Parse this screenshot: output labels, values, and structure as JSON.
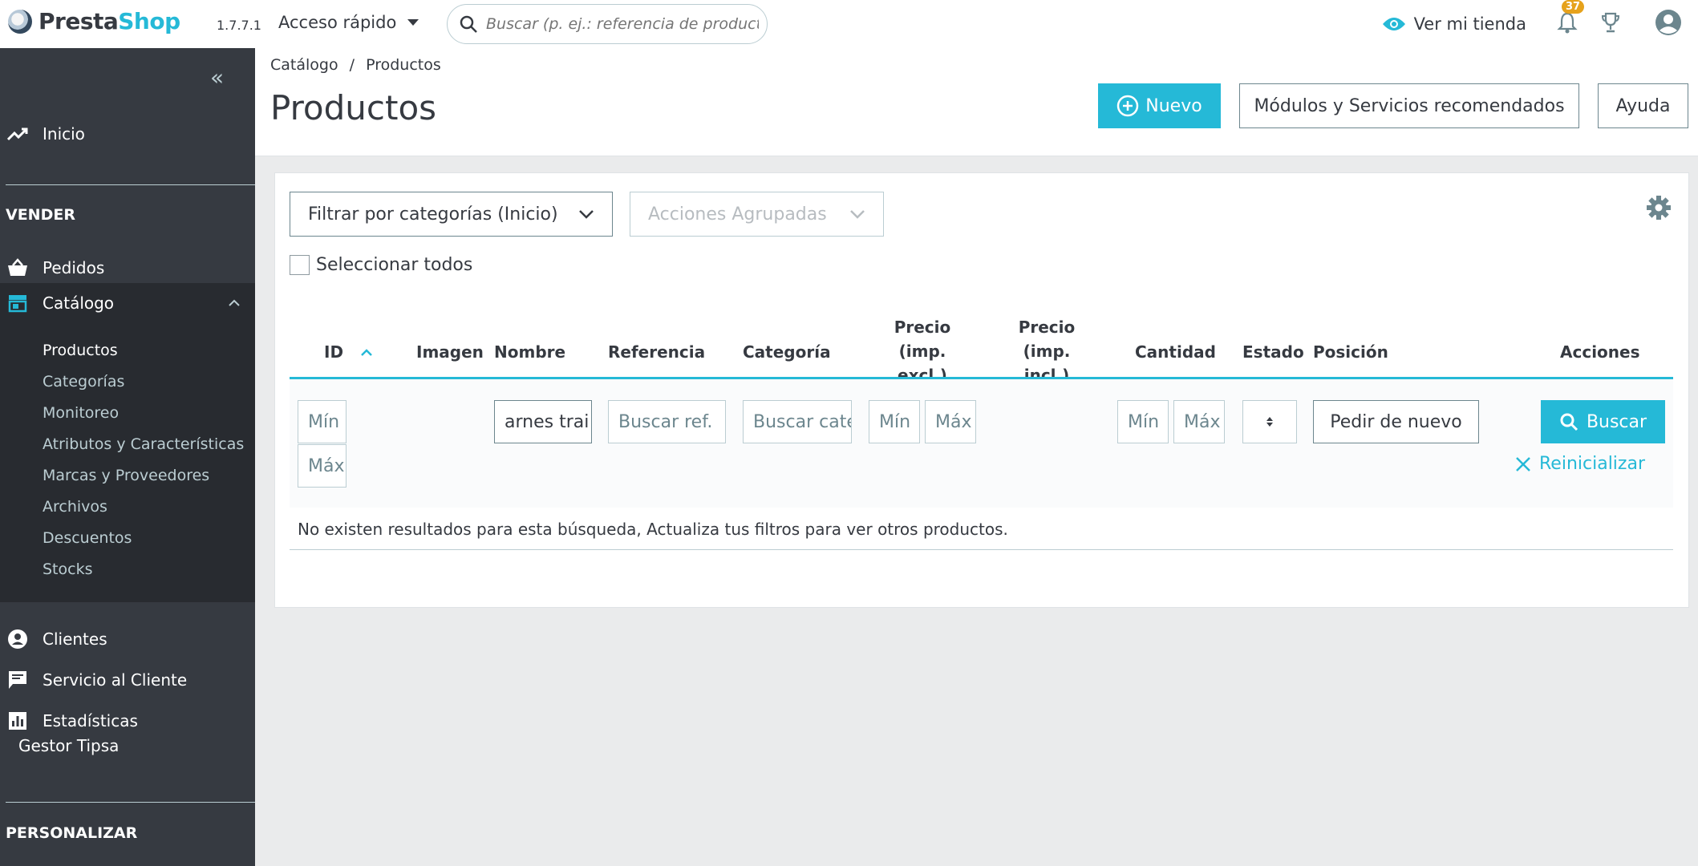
{
  "header": {
    "brand_prefix": "Presta",
    "brand_suffix": "Shop",
    "version": "1.7.7.1",
    "quick_access": "Acceso rápido",
    "search_placeholder": "Buscar (p. ej.: referencia de producto, no",
    "view_store": "Ver mi tienda",
    "notifications_count": "37"
  },
  "sidebar": {
    "home": "Inicio",
    "section_sell": "VENDER",
    "orders": "Pedidos",
    "catalog": "Catálogo",
    "catalog_items": [
      "Productos",
      "Categorías",
      "Monitoreo",
      "Atributos y Características",
      "Marcas y Proveedores",
      "Archivos",
      "Descuentos",
      "Stocks"
    ],
    "customers": "Clientes",
    "customer_service": "Servicio al Cliente",
    "stats": "Estadísticas",
    "gestor": "Gestor Tipsa",
    "section_customize": "PERSONALIZAR"
  },
  "breadcrumb": {
    "parent": "Catálogo",
    "separator": "/",
    "current": "Productos"
  },
  "page_title": "Productos",
  "toolbar": {
    "new_label": "Nuevo",
    "modules_label": "Módulos y Servicios recomendados",
    "help_label": "Ayuda"
  },
  "filters": {
    "category_dropdown": "Filtrar por categorías (Inicio)",
    "bulk_actions": "Acciones Agrupadas",
    "select_all": "Seleccionar todos"
  },
  "table": {
    "headers": {
      "id": "ID",
      "image": "Imagen",
      "name": "Nombre",
      "reference": "Referencia",
      "category": "Categoría",
      "price_excl_1": "Precio (imp.",
      "price_excl_2": "excl.)",
      "price_incl_1": "Precio (imp.",
      "price_incl_2": "incl.)",
      "quantity": "Cantidad",
      "status": "Estado",
      "position": "Posición",
      "actions": "Acciones"
    },
    "filter_inputs": {
      "id_min": "Mín",
      "id_max": "Máx",
      "name_value": "arnes trai",
      "reference_placeholder": "Buscar ref.",
      "category_placeholder": "Buscar cate",
      "price_min": "Mín",
      "price_max": "Máx",
      "qty_min": "Mín",
      "qty_max": "Máx"
    },
    "reorder_label": "Pedir de nuevo",
    "search_label": "Buscar",
    "reset_label": "Reinicializar",
    "no_results": "No existen resultados para esta búsqueda, Actualiza tus filtros para ver otros productos."
  },
  "colors": {
    "accent": "#25b9d7",
    "sidebar": "#363a41",
    "sidebar_active": "#282b30",
    "badge": "#e6a21c"
  }
}
